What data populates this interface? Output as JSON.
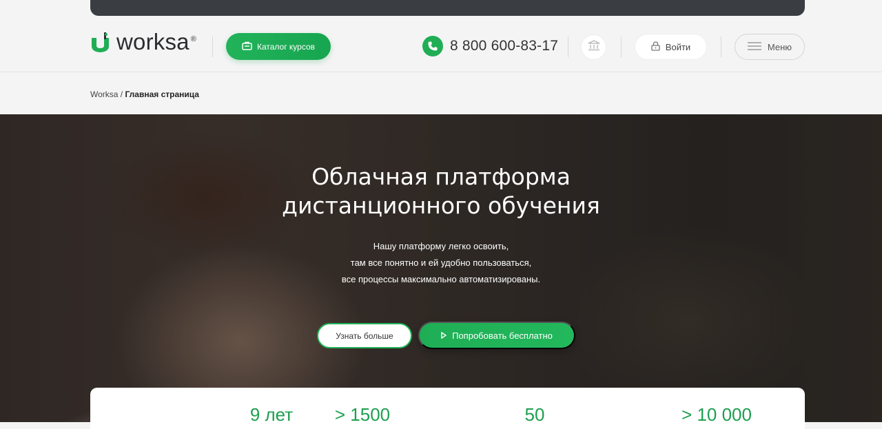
{
  "header": {
    "logo_text": "worksa",
    "logo_reg": "®",
    "catalog_button": "Каталог курсов",
    "phone": "8 800 600-83-17",
    "login_button": "Войти",
    "menu_button": "Меню"
  },
  "breadcrumb": {
    "root": "Worksa",
    "separator": " / ",
    "current": "Главная страница"
  },
  "hero": {
    "title_line1": "Облачная платформа",
    "title_line2": "дистанционного обучения",
    "sub_line1": "Нашу платформу легко освоить,",
    "sub_line2": "там все понятно и ей удобно пользоваться,",
    "sub_line3": "все процессы максимально автоматизированы.",
    "more_button": "Узнать больше",
    "try_button": "Попробовать бесплатно"
  },
  "stats": [
    "9 лет",
    "> 1500",
    "50",
    "> 10 000"
  ],
  "colors": {
    "brand_green": "#1fae55",
    "topbar_dark": "#3a3d42",
    "header_bg": "#f4f4f4"
  },
  "icons": [
    "logo-icon",
    "briefcase-icon",
    "phone-icon",
    "bank-icon",
    "lock-icon",
    "hamburger-icon",
    "play-icon"
  ]
}
